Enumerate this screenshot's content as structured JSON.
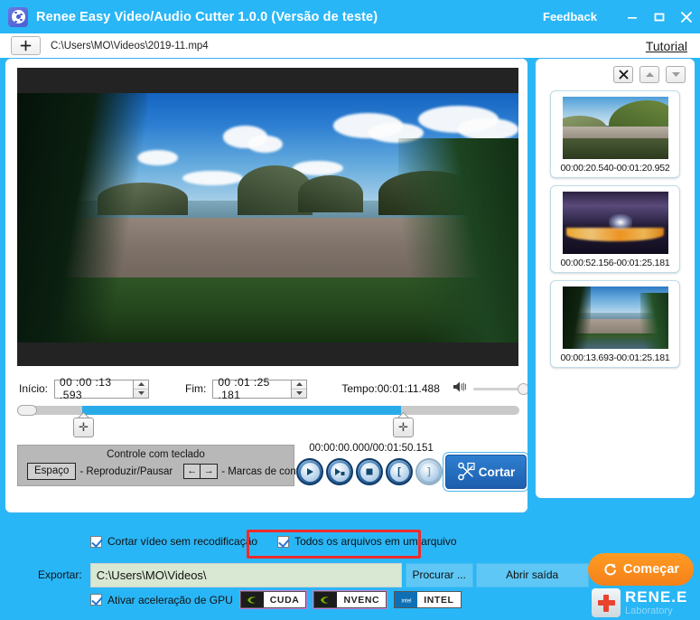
{
  "titlebar": {
    "app_icon": "film-reel-icon",
    "title": "Renee Easy Video/Audio Cutter 1.0.0 (Versão de teste)",
    "feedback": "Feedback",
    "minimize": "minimize-icon",
    "maximize": "maximize-icon",
    "close": "close-icon"
  },
  "toolbar": {
    "add_button": "+",
    "file_path": "C:\\Users\\MO\\Videos\\2019-11.mp4",
    "tutorial": "Tutorial"
  },
  "player": {
    "start_label": "Início:",
    "start_value": "00 :00 :13 .593",
    "end_label": "Fim:",
    "end_value": "00 :01 :25 .181",
    "tempo": "Tempo:00:01:11.488",
    "volume_icon": "speaker-icon",
    "transport_time": "00:00:00.000/00:01:50.151",
    "buttons": {
      "play": "play-icon",
      "play_selection": "play-selection-icon",
      "stop": "stop-icon",
      "mark_in": "[",
      "mark_out": "]"
    },
    "cut_button": "Cortar"
  },
  "keyboard_panel": {
    "title": "Controle com teclado",
    "space_key": "Espaço",
    "space_desc": "- Reproduzir/Pausar",
    "left_key": "←",
    "right_key": "→",
    "arrow_desc": "- Marcas de controle"
  },
  "sidebar": {
    "tools": {
      "delete": "close-icon",
      "move_up": "chevron-up-icon",
      "move_down": "chevron-down-icon"
    },
    "clips": [
      {
        "range": "00:00:20.540-00:01:20.952",
        "thumb": "daytime-hillside-city"
      },
      {
        "range": "00:00:52.156-00:01:25.181",
        "thumb": "night-bay-lights"
      },
      {
        "range": "00:00:13.693-00:01:25.181",
        "thumb": "bay-with-trees"
      }
    ]
  },
  "bottom": {
    "checkbox_no_reencode": "Cortar vídeo sem recodificação",
    "checkbox_single_file": "Todos os arquivos em um arquivo",
    "export_label": "Exportar:",
    "export_path": "C:\\Users\\MO\\Videos\\",
    "browse_button": "Procurar ...",
    "open_output_button": "Abrir saída",
    "gpu_label": "Ativar aceleração de GPU",
    "gpu_badges": [
      "CUDA",
      "NVENC",
      "INTEL"
    ],
    "start_button": "Começar"
  },
  "brand": {
    "name": "RENE.E",
    "sub": "Laboratory"
  },
  "colors": {
    "window_blue": "#29b6f6",
    "panel_border": "#3ab3ee",
    "timeline_selection": "#29abe8",
    "start_orange": "#f5811a",
    "highlight_red": "#ef2b2b",
    "export_field": "#d8e8d2"
  }
}
